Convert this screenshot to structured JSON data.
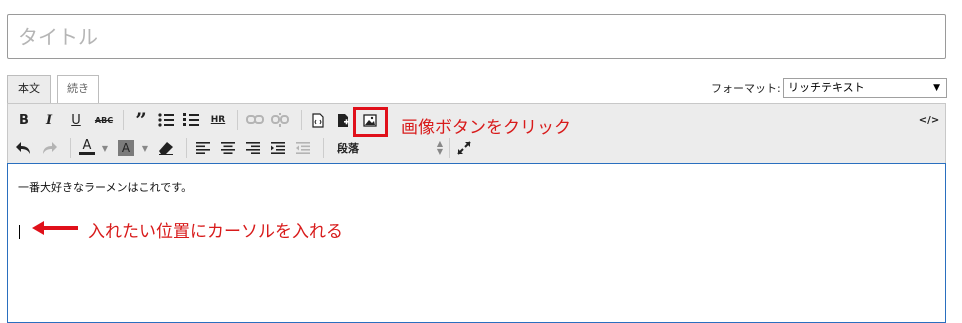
{
  "title_field": {
    "placeholder": "タイトル"
  },
  "tabs": [
    {
      "label": "本文",
      "active": true
    },
    {
      "label": "続き",
      "active": false
    }
  ],
  "format": {
    "label": "フォーマット:",
    "selected": "リッチテキスト"
  },
  "toolbar": {
    "row1": [
      "bold",
      "italic",
      "underline",
      "strikethrough",
      "blockquote",
      "bullet-list",
      "numbered-list",
      "horizontal-rule",
      "insert-link",
      "remove-link",
      "insert-template",
      "insert-file",
      "insert-image",
      "source-code"
    ],
    "row2": [
      "undo",
      "redo",
      "text-color",
      "background-color",
      "clear-format",
      "align-left",
      "align-center",
      "align-right",
      "indent",
      "outdent",
      "paragraph-format",
      "fullscreen"
    ],
    "paragraph_label": "段落",
    "source_label": "</>",
    "hr_label": "HR",
    "strike_label": "ABC"
  },
  "editor": {
    "content": "一番大好きなラーメンはこれです。"
  },
  "annotations": {
    "image_button_note": "画像ボタンをクリック",
    "cursor_note": "入れたい位置にカーソルを入れる",
    "color": "#d81b1b"
  }
}
